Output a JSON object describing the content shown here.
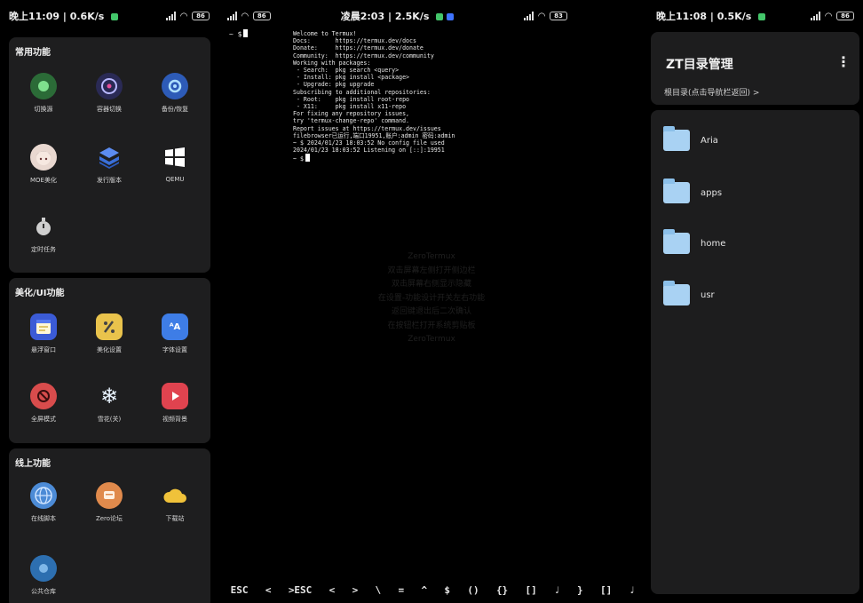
{
  "left": {
    "status": {
      "time": "晚上11:09",
      "speed": "0.6K/s",
      "battery": "86"
    },
    "sections": [
      {
        "title": "常用功能",
        "items": [
          {
            "label": "切换源",
            "icon": "toggle-circle-icon",
            "color": "#2b6b37"
          },
          {
            "label": "容器切换",
            "icon": "disc-icon",
            "color": "#2a2a55"
          },
          {
            "label": "备份/恢复",
            "icon": "backup-icon",
            "color": "#2d5bb7"
          },
          {
            "label": "MOE美化",
            "icon": "anime-avatar-icon",
            "color": "#e9d8d0"
          },
          {
            "label": "发行版本",
            "icon": "stack-cube-icon",
            "color": "#3a6fd8"
          },
          {
            "label": "QEMU",
            "icon": "windows-icon",
            "color": "#1e1e1f"
          },
          {
            "label": "定时任务",
            "icon": "stopwatch-icon",
            "color": "#1e1e1f"
          }
        ]
      },
      {
        "title": "美化/UI功能",
        "items": [
          {
            "label": "悬浮窗口",
            "icon": "window-icon",
            "color": "#3b5bd6"
          },
          {
            "label": "美化设置",
            "icon": "brush-icon",
            "color": "#e9c34c"
          },
          {
            "label": "字体设置",
            "icon": "font-aa-icon",
            "color": "#3e7de6"
          },
          {
            "label": "全屏模式",
            "icon": "fullscreen-off-icon",
            "color": "#d84c4c"
          },
          {
            "label": "雪花(关)",
            "icon": "snowflake-icon",
            "color": "#1e1e1f"
          },
          {
            "label": "视频背景",
            "icon": "video-icon",
            "color": "#e0434f"
          }
        ]
      },
      {
        "title": "线上功能",
        "items": [
          {
            "label": "在线脚本",
            "icon": "globe-icon",
            "color": "#4c8bd6"
          },
          {
            "label": "Zero论坛",
            "icon": "forum-icon",
            "color": "#e08a4c"
          },
          {
            "label": "下载站",
            "icon": "cloud-icon",
            "color": "#e9b93a"
          },
          {
            "label": "公共仓库",
            "icon": "repo-icon",
            "color": "#2d6fb0"
          }
        ]
      }
    ]
  },
  "terminal": {
    "status": {
      "time": "凌晨2:03",
      "speed": "2.5K/s",
      "battery": "83"
    },
    "prompt": "~ $",
    "lines": [
      "Welcome to Termux!",
      "",
      "Docs:       https://termux.dev/docs",
      "Donate:     https://termux.dev/donate",
      "Community:  https://termux.dev/community",
      "",
      "Working with packages:",
      "",
      " - Search:  pkg search <query>",
      " - Install: pkg install <package>",
      " - Upgrade: pkg upgrade",
      "",
      "Subscribing to additional repositories:",
      "",
      " - Root:    pkg install root-repo",
      " - X11:     pkg install x11-repo",
      "",
      "For fixing any repository issues,",
      "try 'termux-change-repo' command.",
      "",
      "Report issues at https://termux.dev/issues",
      "filebrowser已运行,端口19951,账户:admin 密码:admin",
      "~ $ 2024/01/23 18:03:52 No config file used",
      "2024/01/23 18:03:52 Listening on [::]:19951",
      "~ $"
    ],
    "ghost_lines": [
      "ZeroTermux",
      "双击屏幕左侧打开侧边栏",
      "双击屏幕右侧显示隐藏",
      "在设置-功能设计开关左右功能",
      "返回键退出后二次确认",
      "在按钮栏打开系统剪贴板",
      "ZeroTermux"
    ],
    "extra_keys": [
      "ESC",
      "<",
      ">ESC",
      "<",
      ">",
      "\\",
      "=",
      "^",
      "$",
      "()",
      "{}",
      "[]",
      "♩",
      "}",
      "[]",
      "♩"
    ]
  },
  "right": {
    "status": {
      "time": "晚上11:08",
      "speed": "0.5K/s",
      "battery": "86"
    },
    "title": "ZT目录管理",
    "menu_icon": "more-vert-icon",
    "breadcrumb": "根目录(点击导航栏返回)",
    "breadcrumb_arrow": ">",
    "folders": [
      "Aria",
      "apps",
      "home",
      "usr"
    ]
  }
}
